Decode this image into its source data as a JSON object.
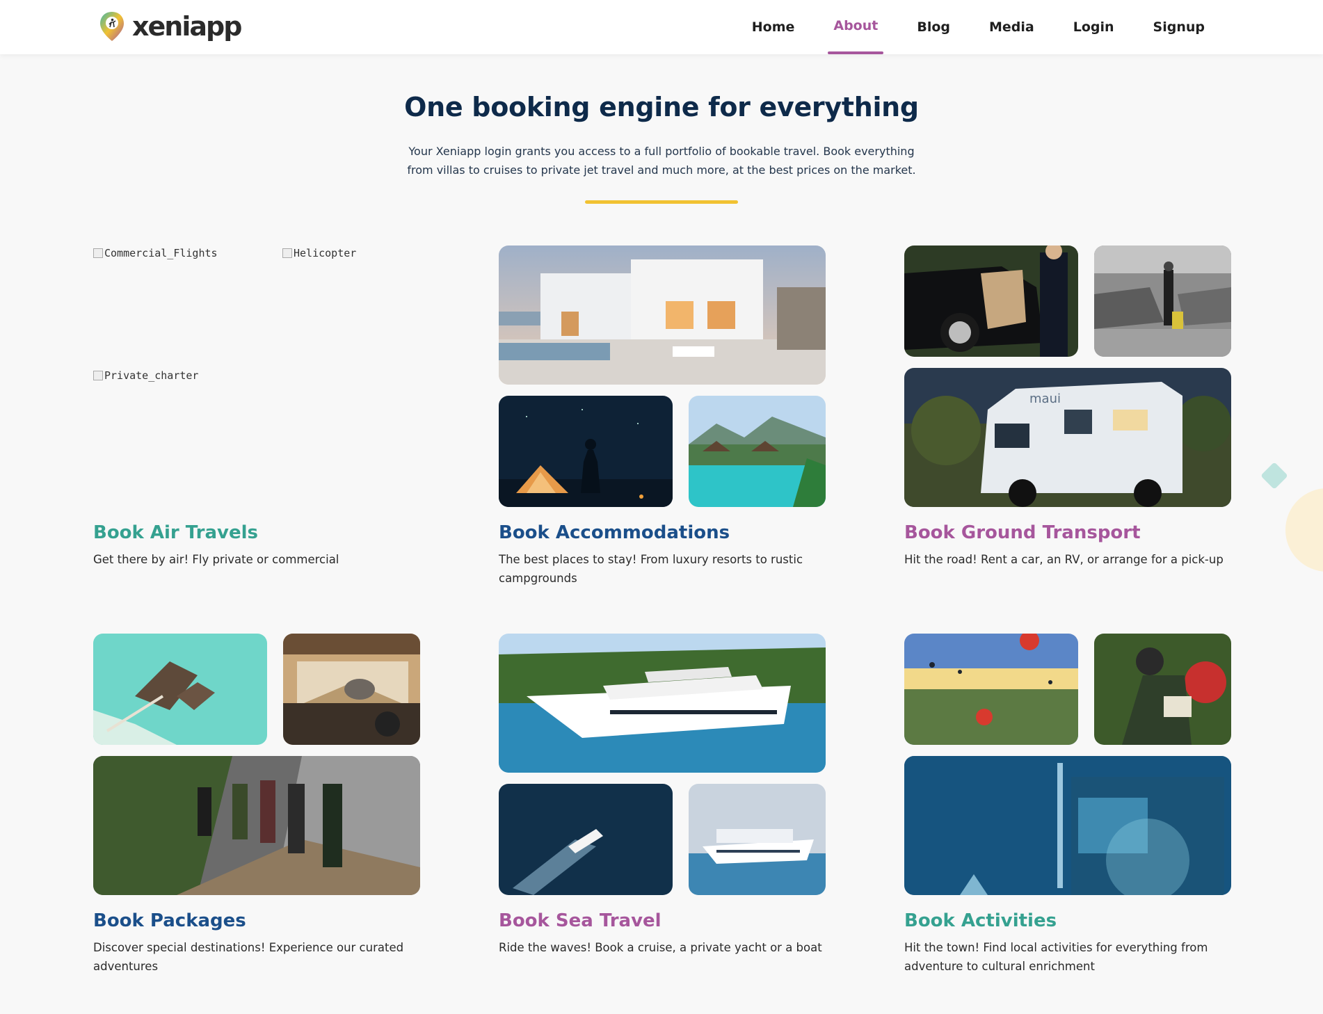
{
  "brand": {
    "name": "xeniapp"
  },
  "nav": {
    "items": [
      {
        "label": "Home",
        "active": false
      },
      {
        "label": "About",
        "active": true
      },
      {
        "label": "Blog",
        "active": false
      },
      {
        "label": "Media",
        "active": false
      },
      {
        "label": "Login",
        "active": false
      },
      {
        "label": "Signup",
        "active": false
      }
    ]
  },
  "intro": {
    "heading": "One booking engine for everything",
    "text": "Your Xeniapp login grants you access to a full portfolio of bookable travel. Book everything from villas to cruises to private jet travel and much more, at the best prices on the market."
  },
  "colors": {
    "accent_purple": "#a6569c",
    "teal": "#2e9e8f",
    "navy": "#1b4f8a",
    "gold_divider": "#f1c232"
  },
  "cards": [
    {
      "title": "Book Air Travels",
      "desc": "Get there by air! Fly private or commercial",
      "color": "#35a190",
      "broken_images": [
        "Commercial_Flights",
        "Helicopter",
        "Private_charter"
      ]
    },
    {
      "title": "Book Accommodations",
      "desc": "The best places to stay! From luxury resorts to rustic campgrounds",
      "color": "#1b4f8a",
      "images": [
        "villa-photo",
        "camping-photo",
        "resort-pool-photo"
      ]
    },
    {
      "title": "Book Ground Transport",
      "desc": "Hit the road! Rent a car, an RV, or arrange for a pick-up",
      "color": "#a6569c",
      "images": [
        "car-door-photo",
        "parking-photo",
        "rv-photo"
      ]
    },
    {
      "title": "Book Packages",
      "desc": "Discover special destinations! Experience our curated adventures",
      "color": "#1b4f8a",
      "images": [
        "overwater-villa-photo",
        "safari-photo",
        "hiking-group-photo"
      ]
    },
    {
      "title": "Book Sea Travel",
      "desc": "Ride the waves! Book a cruise, a private yacht or a boat",
      "color": "#a6569c",
      "images": [
        "yacht-photo",
        "speedboat-photo",
        "cruise-ship-photo"
      ]
    },
    {
      "title": "Book Activities",
      "desc": "Hit the town! Find local activities for everything from adventure to cultural enrichment",
      "color": "#35a190",
      "images": [
        "balloons-photo",
        "backpacker-photo",
        "concert-photo"
      ]
    }
  ]
}
